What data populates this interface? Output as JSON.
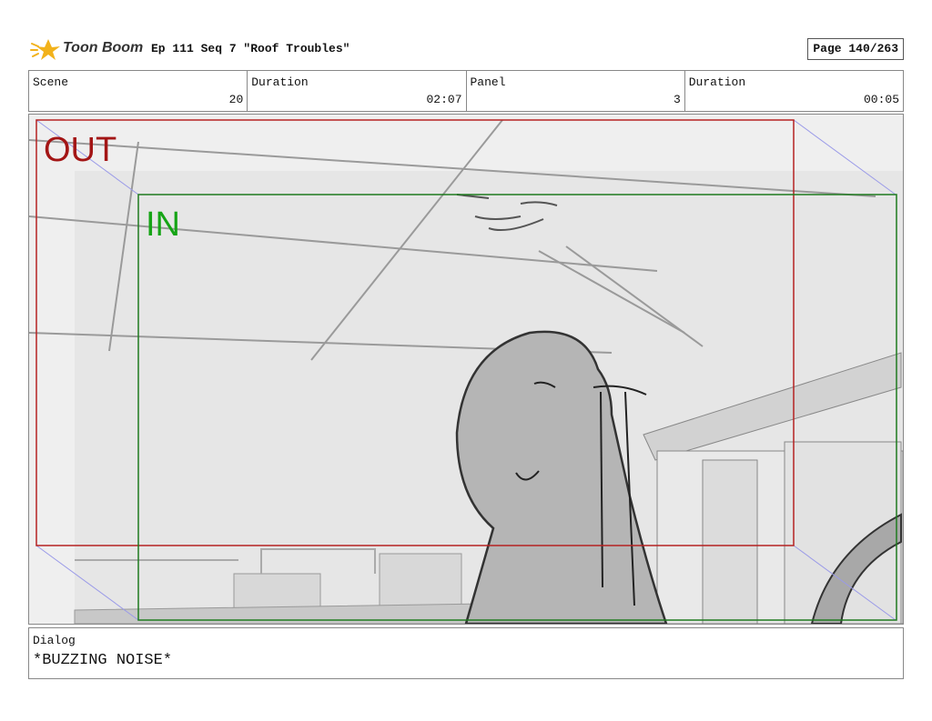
{
  "header": {
    "brand": "Toon Boom",
    "title": "Ep 111 Seq 7 \"Roof Troubles\"",
    "page": "Page 140/263"
  },
  "meta": {
    "scene_label": "Scene",
    "scene_value": "20",
    "scene_duration_label": "Duration",
    "scene_duration_value": "02:07",
    "panel_label": "Panel",
    "panel_value": "3",
    "panel_duration_label": "Duration",
    "panel_duration_value": "00:05"
  },
  "frame": {
    "out_label": "OUT",
    "in_label": "IN",
    "out_color": "#a31515",
    "in_color": "#16a416"
  },
  "dialog": {
    "label": "Dialog",
    "text": "*BUZZING NOISE*"
  }
}
